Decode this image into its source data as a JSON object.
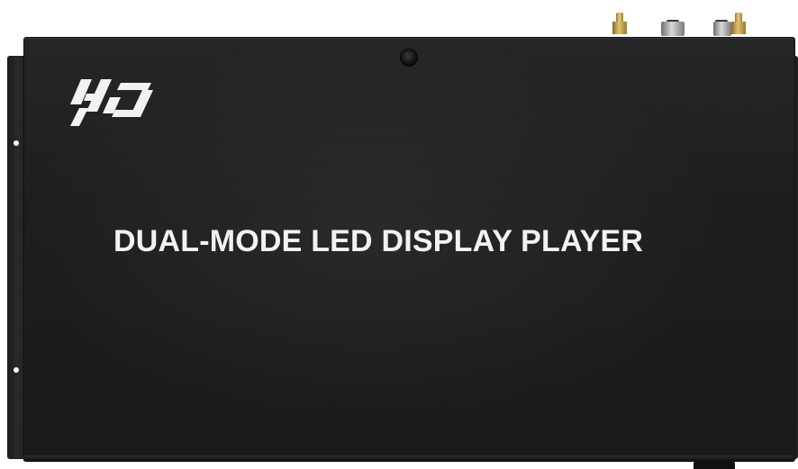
{
  "device": {
    "product_title": "DUAL-MODE LED DISPLAY PLAYER",
    "logo_text": "HD",
    "colors": {
      "enclosure": "#1e1e1e",
      "print": "#f2f2f2",
      "background": "#ffffff",
      "antenna_connector": "#d4b25a"
    },
    "connectors": [
      "antenna-connector-icon",
      "bnc-connector-icon",
      "antenna-connector-icon"
    ]
  }
}
